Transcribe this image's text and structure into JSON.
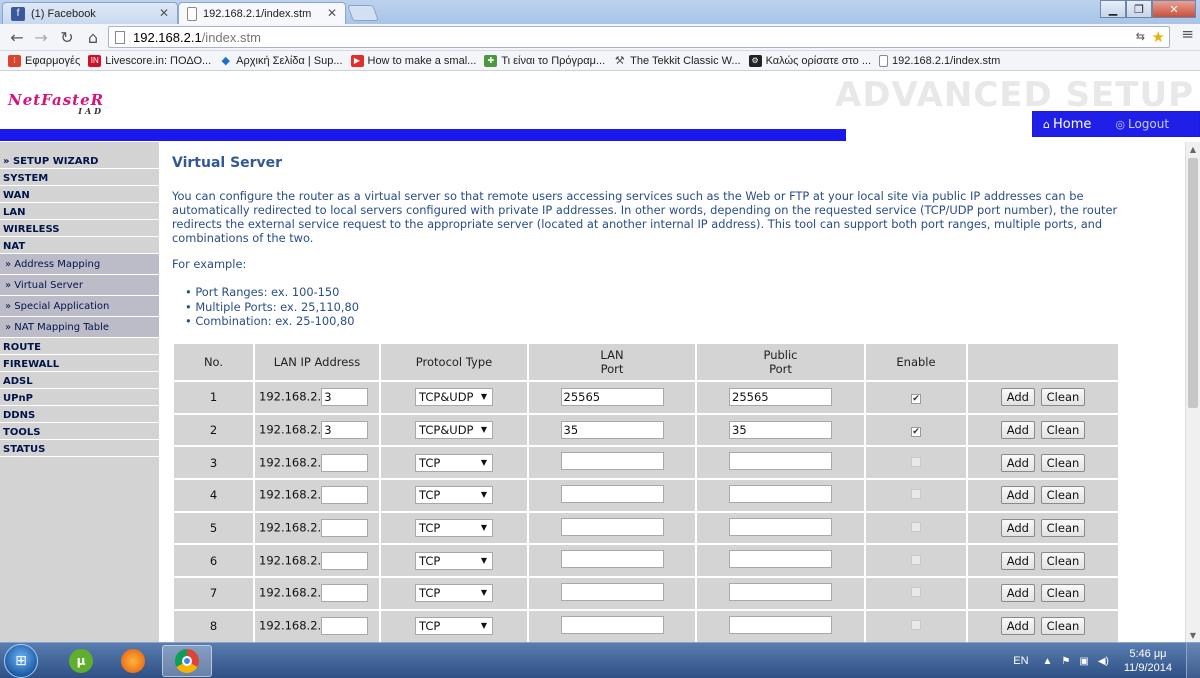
{
  "browser": {
    "tabs": [
      {
        "title": "(1) Facebook",
        "favicon": "facebook-icon",
        "active": false
      },
      {
        "title": "192.168.2.1/index.stm",
        "favicon": "page-icon",
        "active": true
      }
    ],
    "url_host": "192.168.2.1",
    "url_path": "/index.stm",
    "bookmarks": [
      {
        "label": "Εφαρμογές",
        "icon": "apps-icon"
      },
      {
        "label": "Livescore.in: ΠΟΔΟ...",
        "icon": "livescore-icon"
      },
      {
        "label": "Αρχική Σελίδα | Sup...",
        "icon": "diamond-icon"
      },
      {
        "label": "How to make a smal...",
        "icon": "youtube-icon"
      },
      {
        "label": "Τι είναι το Πρόγραμ...",
        "icon": "puzzle-icon"
      },
      {
        "label": "The Tekkit Classic W...",
        "icon": "pickaxe-icon"
      },
      {
        "label": "Καλώς ορίσατε στο ...",
        "icon": "steam-icon"
      },
      {
        "label": "192.168.2.1/index.stm",
        "icon": "page-icon"
      }
    ]
  },
  "router": {
    "logo_text": "NetFasteR",
    "logo_sub": "IAD",
    "banner": "ADVANCED SETUP",
    "home_label": "Home",
    "logout_label": "Logout",
    "menu": [
      {
        "label": "» SETUP WIZARD",
        "sub": false
      },
      {
        "label": "SYSTEM",
        "sub": false
      },
      {
        "label": "WAN",
        "sub": false
      },
      {
        "label": "LAN",
        "sub": false
      },
      {
        "label": "WIRELESS",
        "sub": false
      },
      {
        "label": "NAT",
        "sub": false
      },
      {
        "label": "» Address Mapping",
        "sub": true
      },
      {
        "label": "» Virtual Server",
        "sub": true
      },
      {
        "label": "» Special Application",
        "sub": true
      },
      {
        "label": "» NAT Mapping Table",
        "sub": true
      },
      {
        "label": "ROUTE",
        "sub": false
      },
      {
        "label": "FIREWALL",
        "sub": false
      },
      {
        "label": "ADSL",
        "sub": false
      },
      {
        "label": "UPnP",
        "sub": false
      },
      {
        "label": "DDNS",
        "sub": false
      },
      {
        "label": "TOOLS",
        "sub": false
      },
      {
        "label": "STATUS",
        "sub": false
      }
    ],
    "title": "Virtual Server",
    "description": "You can configure the router as a virtual server so that remote users accessing services such as the Web or FTP at your local site via public IP addresses can be automatically redirected to local servers configured with private IP addresses. In other words, depending on the requested service (TCP/UDP port number), the router redirects the external service request to the appropriate server (located at another internal IP address). This tool can support both port ranges, multiple ports, and combinations of the two.",
    "example_label": "For example:",
    "examples": [
      "Port Ranges: ex. 100-150",
      "Multiple Ports: ex. 25,110,80",
      "Combination: ex. 25-100,80"
    ],
    "table": {
      "headers": {
        "no": "No.",
        "lan_ip": "LAN IP Address",
        "protocol": "Protocol Type",
        "lan_port_1": "LAN",
        "lan_port_2": "Port",
        "public_port_1": "Public",
        "public_port_2": "Port",
        "enable": "Enable"
      },
      "ip_prefix": "192.168.2.",
      "add_label": "Add",
      "clean_label": "Clean",
      "rows": [
        {
          "no": "1",
          "ip": "3",
          "protocol": "TCP&UDP",
          "lan_port": "25565",
          "public_port": "25565",
          "enabled": true
        },
        {
          "no": "2",
          "ip": "3",
          "protocol": "TCP&UDP",
          "lan_port": "35",
          "public_port": "35",
          "enabled": true
        },
        {
          "no": "3",
          "ip": "",
          "protocol": "TCP",
          "lan_port": "",
          "public_port": "",
          "enabled": false
        },
        {
          "no": "4",
          "ip": "",
          "protocol": "TCP",
          "lan_port": "",
          "public_port": "",
          "enabled": false
        },
        {
          "no": "5",
          "ip": "",
          "protocol": "TCP",
          "lan_port": "",
          "public_port": "",
          "enabled": false
        },
        {
          "no": "6",
          "ip": "",
          "protocol": "TCP",
          "lan_port": "",
          "public_port": "",
          "enabled": false
        },
        {
          "no": "7",
          "ip": "",
          "protocol": "TCP",
          "lan_port": "",
          "public_port": "",
          "enabled": false
        },
        {
          "no": "8",
          "ip": "",
          "protocol": "TCP",
          "lan_port": "",
          "public_port": "",
          "enabled": false
        }
      ]
    }
  },
  "taskbar": {
    "language": "EN",
    "time": "5:46 μμ",
    "date": "11/9/2014"
  }
}
